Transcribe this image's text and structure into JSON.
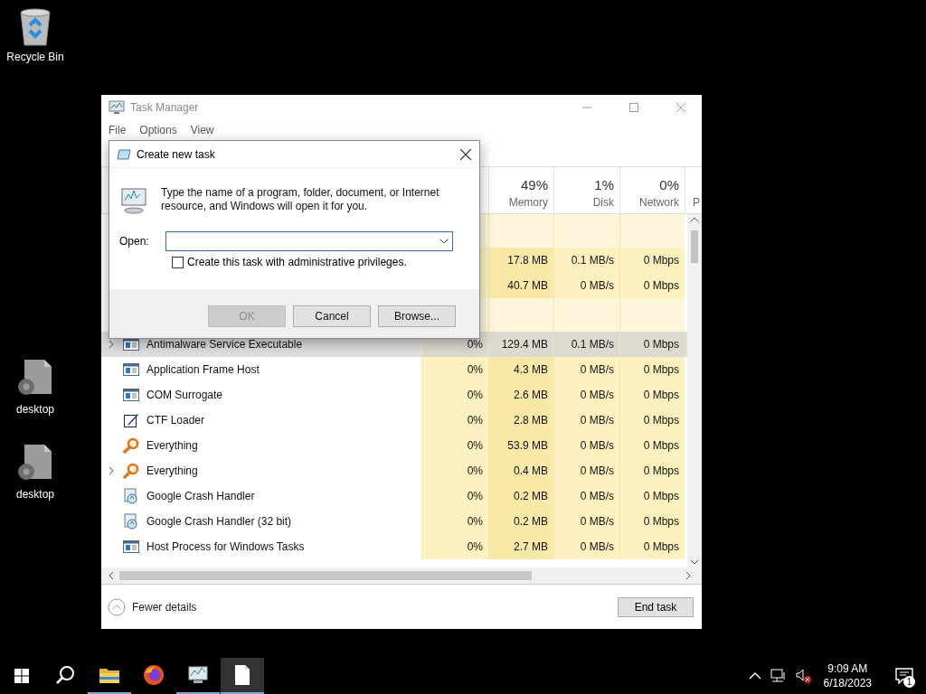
{
  "desktop_icons": [
    {
      "label": "Recycle Bin",
      "kind": "recycle-bin"
    },
    {
      "label": "desktop",
      "kind": "file"
    },
    {
      "label": "desktop",
      "kind": "file"
    }
  ],
  "task_manager": {
    "title": "Task Manager",
    "menu": [
      "File",
      "Options",
      "View"
    ],
    "columns": [
      {
        "percent": "49%",
        "label": "Memory"
      },
      {
        "percent": "1%",
        "label": "Disk"
      },
      {
        "percent": "0%",
        "label": "Network"
      }
    ],
    "cut_column": "P",
    "rows": [
      {
        "kind": "group",
        "selected": false
      },
      {
        "kind": "process",
        "memory": "17.8 MB",
        "disk": "0.1 MB/s",
        "network": "0 Mbps",
        "selected": false
      },
      {
        "kind": "process",
        "memory": "40.7 MB",
        "disk": "0 MB/s",
        "network": "0 Mbps",
        "selected": false
      },
      {
        "kind": "group",
        "selected": false
      },
      {
        "kind": "window",
        "name": "Antimalware Service Executable",
        "expandable": true,
        "cpu": "0%",
        "memory": "129.4 MB",
        "disk": "0.1 MB/s",
        "network": "0 Mbps",
        "selected": true
      },
      {
        "kind": "window",
        "name": "Application Frame Host",
        "expandable": false,
        "cpu": "0%",
        "memory": "4.3 MB",
        "disk": "0 MB/s",
        "network": "0 Mbps",
        "selected": false
      },
      {
        "kind": "window",
        "name": "COM Surrogate",
        "expandable": false,
        "cpu": "0%",
        "memory": "2.6 MB",
        "disk": "0 MB/s",
        "network": "0 Mbps",
        "selected": false
      },
      {
        "kind": "pen",
        "name": "CTF Loader",
        "expandable": false,
        "cpu": "0%",
        "memory": "2.8 MB",
        "disk": "0 MB/s",
        "network": "0 Mbps",
        "selected": false
      },
      {
        "kind": "magnifier",
        "name": "Everything",
        "expandable": false,
        "cpu": "0%",
        "memory": "53.9 MB",
        "disk": "0 MB/s",
        "network": "0 Mbps",
        "selected": false
      },
      {
        "kind": "magnifier",
        "name": "Everything",
        "expandable": true,
        "cpu": "0%",
        "memory": "0.4 MB",
        "disk": "0 MB/s",
        "network": "0 Mbps",
        "selected": false
      },
      {
        "kind": "crash",
        "name": "Google Crash Handler",
        "expandable": false,
        "cpu": "0%",
        "memory": "0.2 MB",
        "disk": "0 MB/s",
        "network": "0 Mbps",
        "selected": false
      },
      {
        "kind": "crash",
        "name": "Google Crash Handler (32 bit)",
        "expandable": false,
        "cpu": "0%",
        "memory": "0.2 MB",
        "disk": "0 MB/s",
        "network": "0 Mbps",
        "selected": false
      },
      {
        "kind": "window",
        "name": "Host Process for Windows Tasks",
        "expandable": false,
        "cpu": "0%",
        "memory": "2.7 MB",
        "disk": "0 MB/s",
        "network": "0 Mbps",
        "selected": false
      }
    ],
    "fewer_details": "Fewer details",
    "end_task": "End task"
  },
  "dialog": {
    "title": "Create new task",
    "message": "Type the name of a program, folder, document, or Internet resource, and Windows will open it for you.",
    "open_label": "Open:",
    "admin_checkbox": {
      "label": "Create this task with administrative privileges.",
      "checked": false
    },
    "buttons": [
      {
        "label": "OK",
        "disabled": true
      },
      {
        "label": "Cancel",
        "disabled": false
      },
      {
        "label": "Browse...",
        "disabled": false
      }
    ]
  },
  "taskbar": {
    "apps": [
      {
        "kind": "explorer",
        "running": true,
        "active": false
      },
      {
        "kind": "firefox",
        "running": false,
        "active": false
      },
      {
        "kind": "taskmanager",
        "running": true,
        "active": false
      },
      {
        "kind": "notepad",
        "running": true,
        "active": true
      }
    ],
    "time": "9:09 AM",
    "date": "6/18/2023",
    "notification_count": "1"
  }
}
